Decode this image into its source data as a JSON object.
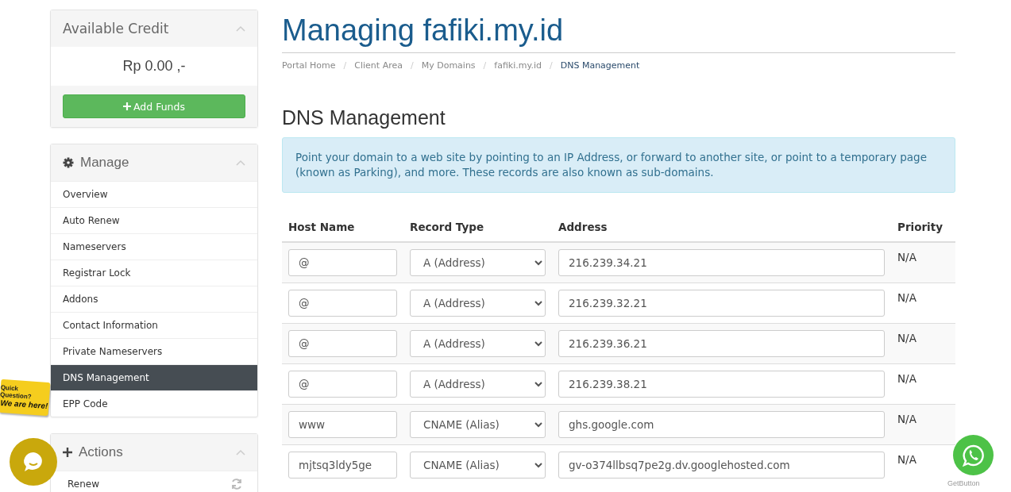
{
  "credit": {
    "title": "Available Credit",
    "amount": "Rp 0.00 ,-",
    "button": "Add Funds"
  },
  "manage": {
    "title": "Manage",
    "items": [
      {
        "label": "Overview",
        "selected": false
      },
      {
        "label": "Auto Renew",
        "selected": false
      },
      {
        "label": "Nameservers",
        "selected": false
      },
      {
        "label": "Registrar Lock",
        "selected": false
      },
      {
        "label": "Addons",
        "selected": false
      },
      {
        "label": "Contact Information",
        "selected": false
      },
      {
        "label": "Private Nameservers",
        "selected": false
      },
      {
        "label": "DNS Management",
        "selected": true
      },
      {
        "label": "EPP Code",
        "selected": false
      }
    ]
  },
  "actions": {
    "title": "Actions",
    "items": [
      {
        "label": "Renew"
      }
    ]
  },
  "page_title": "Managing fafiki.my.id",
  "breadcrumb_separator": "/",
  "breadcrumb": [
    {
      "label": "Portal Home",
      "current": false
    },
    {
      "label": "Client Area",
      "current": false
    },
    {
      "label": "My Domains",
      "current": false
    },
    {
      "label": "fafiki.my.id",
      "current": false
    },
    {
      "label": "DNS Management",
      "current": true
    }
  ],
  "section_title": "DNS Management",
  "info": "Point your domain to a web site by pointing to an IP Address, or forward to another site, or point to a temporary page (known as Parking), and more. These records are also known as sub-domains.",
  "table": {
    "columns": [
      "Host Name",
      "Record Type",
      "Address",
      "Priority"
    ],
    "rows": [
      {
        "host": "@",
        "type": "A (Address)",
        "address": "216.239.34.21",
        "priority": "N/A"
      },
      {
        "host": "@",
        "type": "A (Address)",
        "address": "216.239.32.21",
        "priority": "N/A"
      },
      {
        "host": "@",
        "type": "A (Address)",
        "address": "216.239.36.21",
        "priority": "N/A"
      },
      {
        "host": "@",
        "type": "A (Address)",
        "address": "216.239.38.21",
        "priority": "N/A"
      },
      {
        "host": "www",
        "type": "CNAME (Alias)",
        "address": "ghs.google.com",
        "priority": "N/A"
      },
      {
        "host": "mjtsq3ldy5ge",
        "type": "CNAME (Alias)",
        "address": "gv-o374llbsq7pe2g.dv.googlehosted.com",
        "priority": "N/A"
      }
    ]
  },
  "chat_badge": {
    "line1": "Quick Question?",
    "line2": "We are here!"
  },
  "getbutton": "GetButton"
}
